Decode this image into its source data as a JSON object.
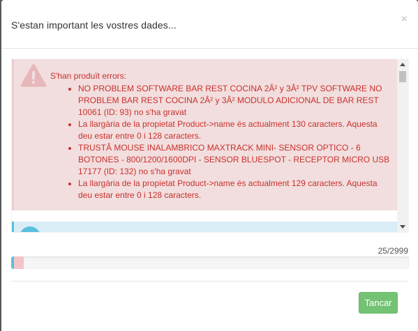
{
  "modal": {
    "title": "S'estan important les vostres dades...",
    "close_symbol": "×"
  },
  "errors": {
    "heading": "S'han produït errors:",
    "items": [
      "NO PROBLEM SOFTWARE BAR REST COCINA 2Â² y 3Â² TPV SOFTWARE NO PROBLEM BAR REST COCINA 2Â² y 3Â² MODULO ADICIONAL DE BAR REST 10061 (ID: 93) no s'ha gravat",
      "La llargària de la propietat Product->name és actualment 130 caracters. Aquesta deu estar entre 0 i 128 caracters.",
      "TRUSTÂ MOUSE INALAMBRICO MAXTRACK MINI- SENSOR OPTICO - 6 BOTONES - 800/1200/1600DPI - SENSOR BLUESPOT - RECEPTOR MICRO USB 17177 (ID: 132) no s'ha gravat",
      "La llargària de la propietat Product->name és actualment 129 caracters. Aquesta deu estar entre 0 i 128 caracters."
    ]
  },
  "progress": {
    "count_text": "25/2999",
    "done": 25,
    "total": 2999,
    "info_fraction": 0.0045,
    "danger_fraction": 0.024
  },
  "footer": {
    "close_label": "Tancar"
  },
  "colors": {
    "danger_text": "#c9302c",
    "danger_bg": "#f2dede",
    "info_bg": "#d9edf7",
    "info_accent": "#5bc0de",
    "success_btn": "#5cb85c"
  },
  "icons": {
    "warning": "warning-triangle-icon",
    "info": "info-circle-icon",
    "close": "close-icon"
  }
}
